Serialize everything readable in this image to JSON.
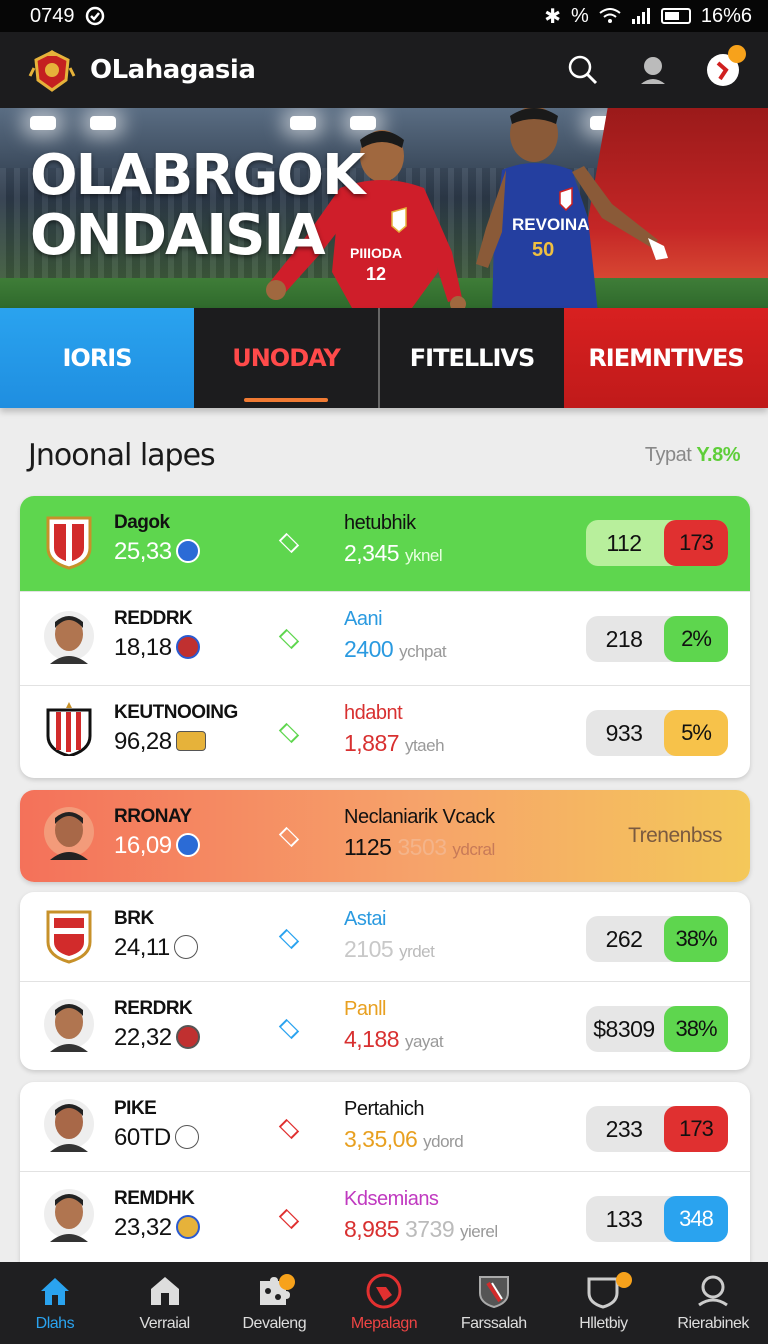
{
  "status_bar": {
    "time": "0749",
    "battery": "16%6"
  },
  "header": {
    "app_name": "OLahagasia",
    "icons": [
      "crest-logo",
      "search-icon",
      "profile-icon",
      "notification-icon"
    ]
  },
  "hero": {
    "title_line1": "OLABRGOK",
    "title_line2": "ONDAISIA",
    "jersey_left_text": "PIIIODA",
    "jersey_left_number": "12",
    "jersey_right_text": "REVOINA",
    "jersey_right_number": "50"
  },
  "tabs": [
    {
      "label": "IORIS",
      "color": "#1f8ee0"
    },
    {
      "label": "UNODAY",
      "color": "#1c1c1e",
      "selected": true
    },
    {
      "label": "FITELLIVS",
      "color": "#1c1c1e"
    },
    {
      "label": "RIEMNTIVES",
      "color": "#c01a1a"
    }
  ],
  "section": {
    "title": "Jnoonal lapes",
    "meta_label": "Typat",
    "meta_value": "Y.8%"
  },
  "cards": [
    {
      "rows": [
        {
          "name": "Dagok",
          "score": "25,33",
          "event": "hetubhik",
          "event_num": "2,345",
          "event_unit": "yknel",
          "count": "112",
          "pct": "173",
          "pct_color": "#e03030",
          "highlight": "green",
          "avatar": "crest",
          "event_color": "#111"
        },
        {
          "name": "REDDRK",
          "score": "18,18",
          "event": "Aani",
          "event_num": "2400",
          "event_unit": "ychpat",
          "count": "218",
          "pct": "2%",
          "pct_color": "#5ed64e",
          "avatar": "face",
          "event_color": "#2a9ae0"
        },
        {
          "name": "KEUTNOOING",
          "score": "96,28",
          "event": "hdabnt",
          "event_num": "1,887",
          "event_unit": "ytaeh",
          "count": "933",
          "pct": "5%",
          "pct_color": "#f7c24a",
          "avatar": "crest2",
          "event_color": "#d83030"
        }
      ]
    },
    {
      "rows": [
        {
          "name": "RRONAY",
          "score": "16,09",
          "event": "Neclaniarik Vcack",
          "event_num": "1125",
          "event_num2": "3503",
          "event_unit": "ydcral",
          "trend_label": "Trenenbss",
          "highlight": "grad",
          "avatar": "face"
        }
      ]
    },
    {
      "rows": [
        {
          "name": "BRK",
          "score": "24,11",
          "event": "Astai",
          "event_num": "2105",
          "event_unit": "yrdet",
          "count": "262",
          "pct": "38%",
          "pct_color": "#5ed64e",
          "avatar": "crest",
          "event_color": "#2a9ae0"
        },
        {
          "name": "RERDRK",
          "score": "22,32",
          "event": "Panll",
          "event_num": "4,188",
          "event_unit": "yayat",
          "count": "$8309",
          "pct": "38%",
          "pct_color": "#5ed64e",
          "avatar": "face",
          "event_color": "#e8a020"
        }
      ]
    },
    {
      "rows": [
        {
          "name": "PIKE",
          "score": "60TD",
          "event": "Pertahich",
          "event_num": "3,35,06",
          "event_unit": "ydord",
          "count": "233",
          "pct": "173",
          "pct_color": "#e03030",
          "avatar": "face",
          "event_color": "#111"
        },
        {
          "name": "REMDHK",
          "score": "23,32",
          "event": "Kdsemians",
          "event_num": "8,985",
          "event_num2": "3739",
          "event_unit": "yierel",
          "count": "133",
          "pct": "348",
          "pct_color": "#2aa3ef",
          "avatar": "face",
          "event_color": "#c03ac0"
        }
      ]
    }
  ],
  "bottom_nav": [
    {
      "label": "Dlahs",
      "icon": "home-icon",
      "state": "active"
    },
    {
      "label": "Verraial",
      "icon": "house-icon"
    },
    {
      "label": "Devaleng",
      "icon": "puzzle-icon"
    },
    {
      "label": "Mepalagn",
      "icon": "heart-badge-icon",
      "state": "red"
    },
    {
      "label": "Farssalah",
      "icon": "shield-icon"
    },
    {
      "label": "Hlletbiy",
      "icon": "shield-outline-icon"
    },
    {
      "label": "Rierabinek",
      "icon": "person-icon"
    }
  ]
}
